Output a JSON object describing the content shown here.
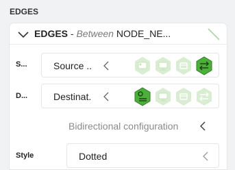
{
  "section": {
    "title": "EDGES"
  },
  "header": {
    "prefix": "EDGES",
    "separator": " - ",
    "between": "Between",
    "node": " NODE_NE..."
  },
  "rows": {
    "source": {
      "label": "S...",
      "value": "Source ..",
      "icons": [
        "image-node-icon",
        "monitor-node-icon",
        "box-node-icon",
        "swap-arrows-icon"
      ]
    },
    "destination": {
      "label": "D...",
      "value": "Destinat.",
      "icons": [
        "image-node-icon",
        "monitor-node-icon",
        "box-node-icon",
        "swap-arrows-icon"
      ]
    }
  },
  "bidirectional": {
    "label": "Bidirectional configuration"
  },
  "style": {
    "label": "Style",
    "value": "Dotted"
  },
  "colors": {
    "accent": "#4caf3a",
    "accent_light": "#d9edd2",
    "text": "#222222",
    "muted": "#8a8a8a"
  }
}
